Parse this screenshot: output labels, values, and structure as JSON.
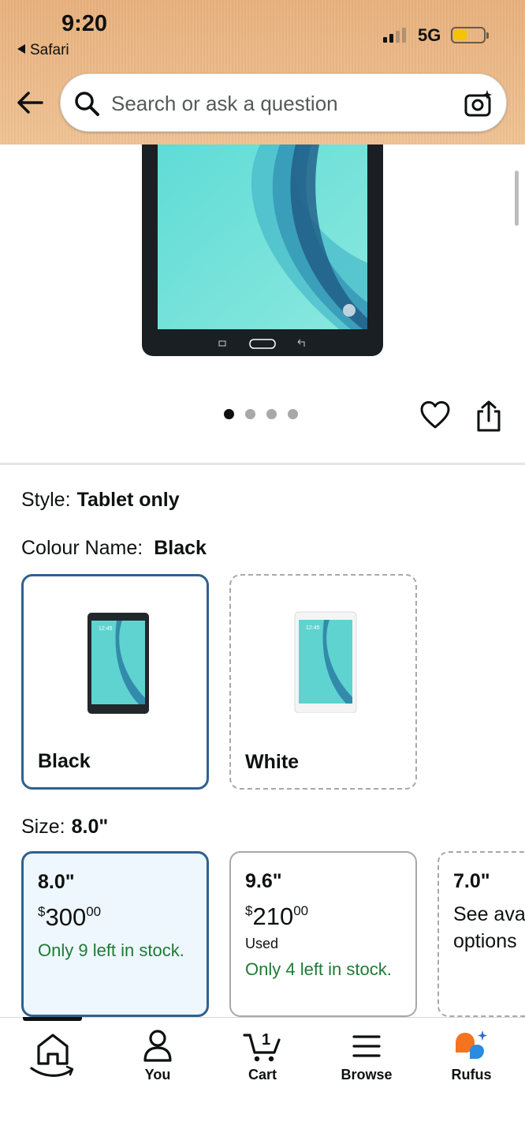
{
  "status_bar": {
    "time": "9:20",
    "back_app": "Safari",
    "network": "5G"
  },
  "search": {
    "placeholder": "Search or ask a question"
  },
  "gallery": {
    "image_count": 4,
    "active_index": 0
  },
  "style": {
    "label": "Style:",
    "value": "Tablet only"
  },
  "colour": {
    "label": "Colour Name:",
    "value": "Black",
    "options": [
      {
        "name": "Black",
        "selected": true
      },
      {
        "name": "White",
        "selected": false
      }
    ]
  },
  "size": {
    "label": "Size:",
    "value": "8.0\"",
    "options": [
      {
        "size": "8.0\"",
        "currency": "$",
        "price_main": "300",
        "price_cents": "00",
        "condition": "",
        "stock": "Only 9 left in stock."
      },
      {
        "size": "9.6\"",
        "currency": "$",
        "price_main": "210",
        "price_cents": "00",
        "condition": "Used",
        "stock": "Only 4 left in stock."
      },
      {
        "size": "7.0\"",
        "see_options": "See available options"
      }
    ]
  },
  "bottom_nav": {
    "items": [
      {
        "label": "",
        "icon": "home-icon"
      },
      {
        "label": "You",
        "icon": "person-icon"
      },
      {
        "label": "Cart",
        "icon": "cart-icon",
        "badge": "1"
      },
      {
        "label": "Browse",
        "icon": "menu-icon"
      },
      {
        "label": "Rufus",
        "icon": "rufus-icon"
      }
    ]
  },
  "colors": {
    "selected_border": "#2f6191",
    "stock_green": "#1e7a35",
    "header_bg": "#e9b27e"
  }
}
